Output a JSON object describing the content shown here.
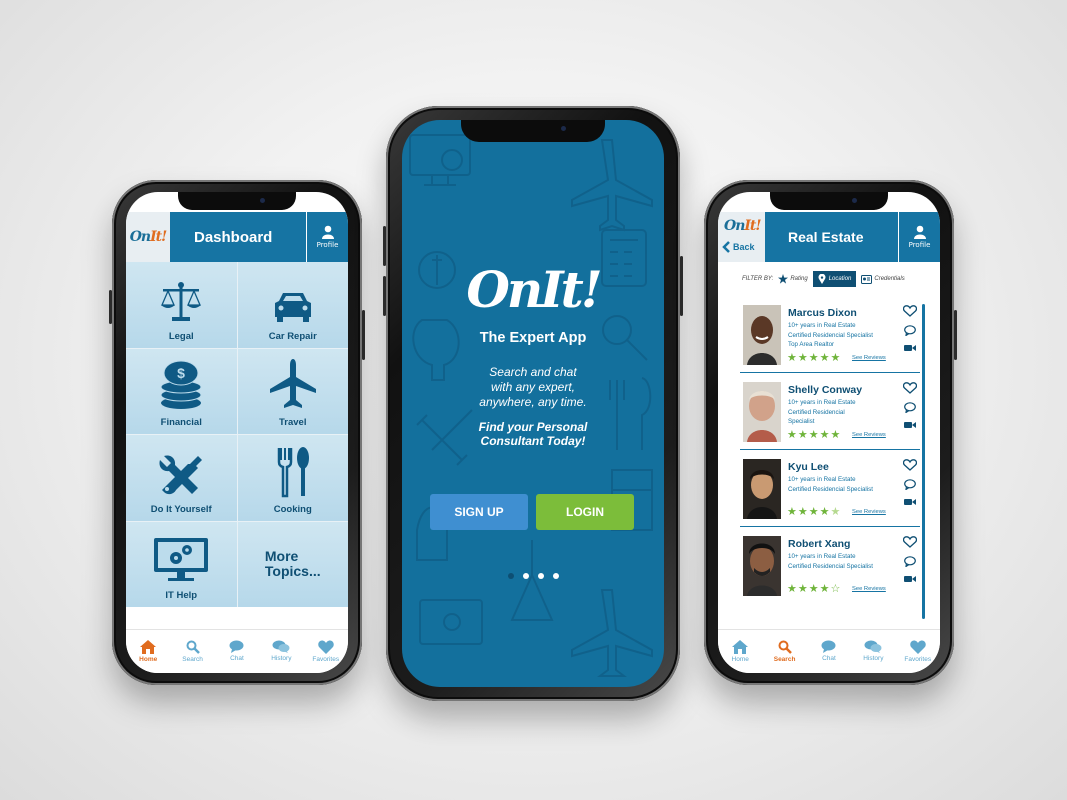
{
  "dashboard": {
    "logo": {
      "on": "On",
      "it": "It!"
    },
    "title": "Dashboard",
    "profile_label": "Profile",
    "topics": [
      {
        "label": "Legal",
        "icon": "scales-icon"
      },
      {
        "label": "Car Repair",
        "icon": "car-icon"
      },
      {
        "label": "Financial",
        "icon": "coins-icon"
      },
      {
        "label": "Travel",
        "icon": "airplane-icon"
      },
      {
        "label": "Do It Yourself",
        "icon": "tools-icon"
      },
      {
        "label": "Cooking",
        "icon": "utensils-icon"
      },
      {
        "label": "IT Help",
        "icon": "computer-icon"
      }
    ],
    "more_topics": "More\nTopics...",
    "tabs": [
      {
        "label": "Home",
        "icon": "home-icon"
      },
      {
        "label": "Search",
        "icon": "search-icon"
      },
      {
        "label": "Chat",
        "icon": "chat-icon"
      },
      {
        "label": "History",
        "icon": "history-icon"
      },
      {
        "label": "Favorites",
        "icon": "heart-icon"
      }
    ],
    "active_tab": "Home"
  },
  "splash": {
    "logo": "OnIt!",
    "tagline": "The Expert App",
    "description": "Search and chat\nwith any expert,\nanywhere, any time.",
    "cta": "Find your Personal\nConsultant Today!",
    "signup_label": "SIGN UP",
    "login_label": "LOGIN",
    "pages": 4,
    "active_page": 1
  },
  "real_estate": {
    "logo": {
      "on": "On",
      "it": "It!"
    },
    "back_label": "Back",
    "title": "Real Estate",
    "profile_label": "Profile",
    "filter": {
      "label": "FILTER BY:",
      "options": [
        "Rating",
        "Location",
        "Credentials"
      ],
      "active": "Location"
    },
    "professionals": [
      {
        "name": "Marcus Dixon",
        "info": "10+ years in Real Estate\nCertified Residencial Specialist\nTop Area Realtor",
        "rating": 5,
        "reviews_label": "See Reviews"
      },
      {
        "name": "Shelly Conway",
        "info": "10+ years in Real Estate\nCertified Residencial\nSpecialist",
        "rating": 5,
        "reviews_label": "See Reviews"
      },
      {
        "name": "Kyu Lee",
        "info": "10+ years in Real Estate\nCertified Residencial Specialist",
        "rating": 4.5,
        "reviews_label": "See Reviews"
      },
      {
        "name": "Robert Xang",
        "info": "10+ years in Real Estate\nCertified Residencial Specialist",
        "rating": 4,
        "reviews_label": "See Reviews"
      }
    ],
    "tabs": [
      {
        "label": "Home",
        "icon": "home-icon"
      },
      {
        "label": "Search",
        "icon": "search-icon"
      },
      {
        "label": "Chat",
        "icon": "chat-icon"
      },
      {
        "label": "History",
        "icon": "history-icon"
      },
      {
        "label": "Favorites",
        "icon": "heart-icon"
      }
    ],
    "active_tab": "Search"
  },
  "colors": {
    "brand_blue": "#1674a3",
    "dark_blue": "#0f4f73",
    "accent_orange": "#e06c1f",
    "login_green": "#7cbd3a",
    "signup_blue": "#3f8fd1",
    "star_green": "#6fb43a"
  }
}
